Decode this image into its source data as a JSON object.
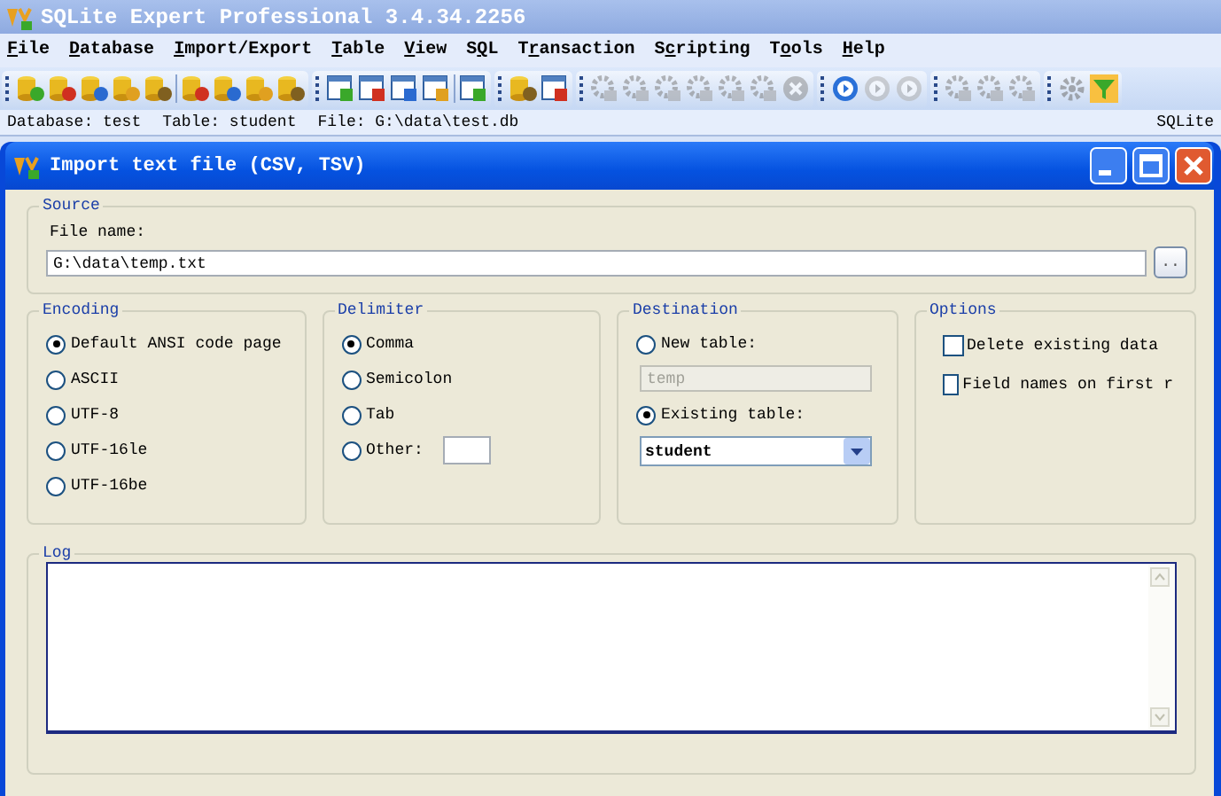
{
  "app": {
    "title": "SQLite Expert Professional 3.4.34.2256"
  },
  "menu": [
    {
      "label": "File"
    },
    {
      "label": "Database"
    },
    {
      "label": "Import/Export"
    },
    {
      "label": "Table"
    },
    {
      "label": "View"
    },
    {
      "label": "SQL"
    },
    {
      "label": "Transaction"
    },
    {
      "label": "Scripting"
    },
    {
      "label": "Tools"
    },
    {
      "label": "Help"
    }
  ],
  "toolbar": [
    [
      {
        "kind": "db",
        "disabled": false
      },
      {
        "kind": "db",
        "disabled": false
      },
      {
        "kind": "db",
        "disabled": false
      },
      {
        "kind": "db",
        "disabled": false
      },
      {
        "kind": "db",
        "disabled": false
      },
      {
        "kind": "sep"
      },
      {
        "kind": "db",
        "disabled": false
      },
      {
        "kind": "db",
        "disabled": false
      },
      {
        "kind": "db",
        "disabled": false
      },
      {
        "kind": "db",
        "disabled": false
      }
    ],
    [
      {
        "kind": "table",
        "disabled": false
      },
      {
        "kind": "table",
        "disabled": false
      },
      {
        "kind": "table",
        "disabled": false
      },
      {
        "kind": "table",
        "disabled": false
      },
      {
        "kind": "sep"
      },
      {
        "kind": "table",
        "disabled": false
      }
    ],
    [
      {
        "kind": "db",
        "disabled": false
      },
      {
        "kind": "table",
        "disabled": false
      }
    ],
    [
      {
        "kind": "script",
        "disabled": true
      },
      {
        "kind": "script",
        "disabled": true
      },
      {
        "kind": "script",
        "disabled": true
      },
      {
        "kind": "script",
        "disabled": true
      },
      {
        "kind": "script",
        "disabled": true
      },
      {
        "kind": "script",
        "disabled": true
      },
      {
        "kind": "stop",
        "disabled": true
      }
    ],
    [
      {
        "kind": "nav",
        "disabled": false
      },
      {
        "kind": "nav",
        "disabled": true
      },
      {
        "kind": "nav",
        "disabled": true
      }
    ],
    [
      {
        "kind": "script",
        "disabled": true
      },
      {
        "kind": "script",
        "disabled": true
      },
      {
        "kind": "script",
        "disabled": true
      }
    ],
    [
      {
        "kind": "gear",
        "disabled": true
      },
      {
        "kind": "filter",
        "disabled": false
      }
    ]
  ],
  "status": {
    "database": "Database: test",
    "table": "Table: student",
    "file": "File: G:\\data\\test.db",
    "engine": "SQLite"
  },
  "dialog": {
    "title": "Import text file (CSV, TSV)",
    "source": {
      "legend": "Source",
      "file_label": "File name:",
      "file_value": "G:\\data\\temp.txt",
      "browse": ".."
    },
    "encoding": {
      "legend": "Encoding",
      "options": [
        {
          "label": "Default ANSI code page",
          "selected": true
        },
        {
          "label": "ASCII",
          "selected": false
        },
        {
          "label": "UTF-8",
          "selected": false
        },
        {
          "label": "UTF-16le",
          "selected": false
        },
        {
          "label": "UTF-16be",
          "selected": false
        }
      ]
    },
    "delimiter": {
      "legend": "Delimiter",
      "options": [
        {
          "label": "Comma",
          "selected": true,
          "kind": "plain"
        },
        {
          "label": "Semicolon",
          "selected": false,
          "kind": "plain"
        },
        {
          "label": "Tab",
          "selected": false,
          "kind": "plain"
        },
        {
          "label": "Other:",
          "selected": false,
          "kind": "other"
        }
      ]
    },
    "destination": {
      "legend": "Destination",
      "new_table": {
        "label": "New table:",
        "selected": false,
        "value": "temp",
        "disabled": true
      },
      "existing_table": {
        "label": "Existing table:",
        "selected": true,
        "value": "student"
      }
    },
    "options": {
      "legend": "Options",
      "items": [
        {
          "label": "Delete existing data",
          "checked": false
        },
        {
          "label": "Field names on first r",
          "checked": false
        }
      ]
    },
    "log": {
      "legend": "Log"
    }
  }
}
